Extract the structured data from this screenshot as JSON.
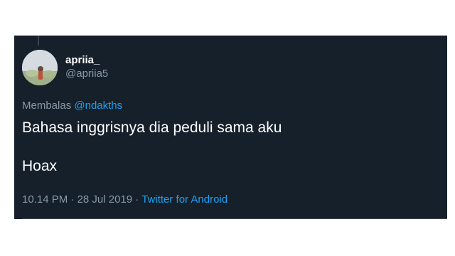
{
  "tweet": {
    "author": {
      "display_name": "apriia_",
      "handle": "@apriia5"
    },
    "reply": {
      "prefix": "Membalas",
      "mention": "@ndakths"
    },
    "text_line1": "Bahasa inggrisnya dia peduli sama aku",
    "text_line2": "Hoax",
    "meta": {
      "time": "10.14 PM",
      "separator1": " · ",
      "date": "28 Jul 2019",
      "separator2": " · ",
      "source": "Twitter for Android"
    }
  },
  "colors": {
    "background": "#15202b",
    "text": "#ffffff",
    "secondary": "#8899a6",
    "accent": "#1da1f2"
  }
}
